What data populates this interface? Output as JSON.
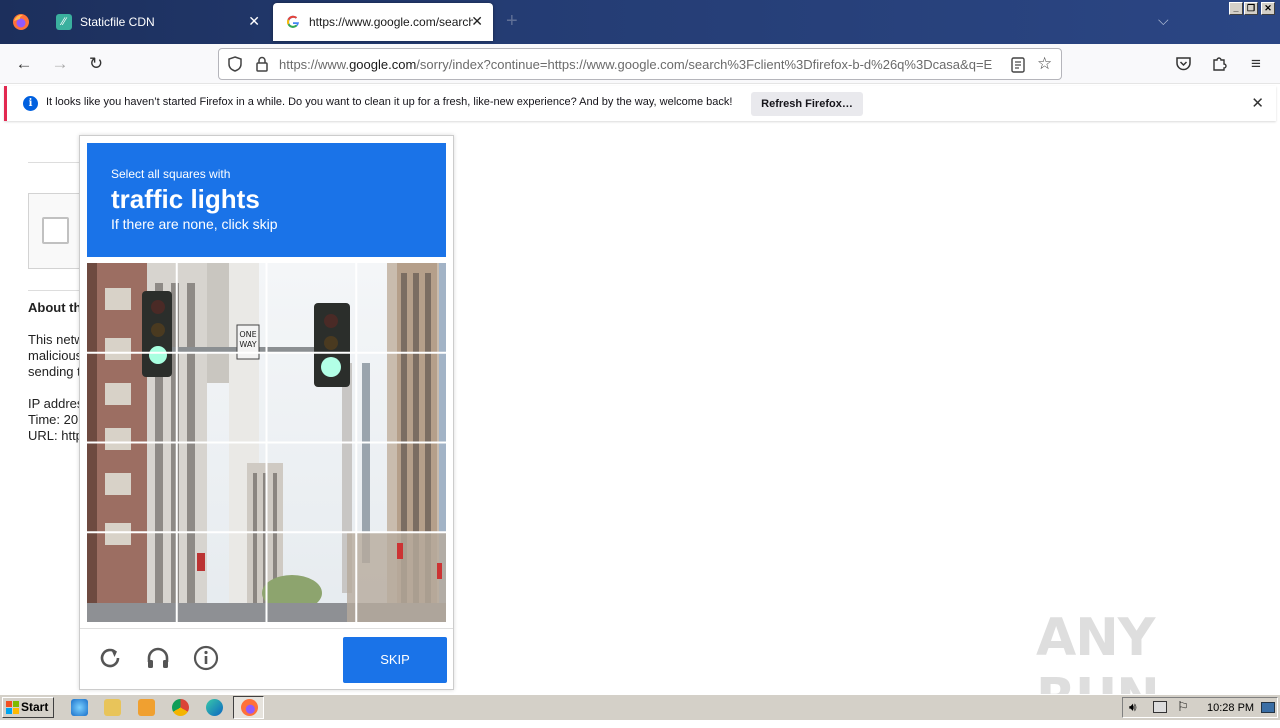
{
  "browser": {
    "tabs": [
      {
        "title": "Staticfile CDN",
        "active": false
      },
      {
        "title": "https://www.google.com/search?c",
        "active": true
      }
    ],
    "new_tab_label": "+",
    "url": {
      "prefix": "https://www.",
      "domain": "google.com",
      "rest": "/sorry/index?continue=https://www.google.com/search%3Fclient%3Dfirefox-b-d%26q%3Dcasa&q=E"
    }
  },
  "notification": {
    "message": "It looks like you haven’t started Firefox in a while. Do you want to clean it up for a fresh, like-new experience? And by the way, welcome back!",
    "button_label": "Refresh Firefox…",
    "close_label": "✕"
  },
  "page": {
    "about_heading": "About th",
    "para_lines": [
      "This netw",
      "malicious",
      "sending t"
    ],
    "ip_line": "IP addres",
    "time_line": "Time: 20",
    "url_line": "URL: http"
  },
  "captcha": {
    "instruction": "Select all squares with",
    "target": "traffic lights",
    "hint": "If there are none, click skip",
    "skip_label": "SKIP"
  },
  "watermark": "ANY RUN",
  "taskbar": {
    "start_label": "Start",
    "clock": "10:28 PM"
  },
  "colors": {
    "captcha_blue": "#1a73e8",
    "tabbar": "#243c73",
    "notification_accent": "#e22850"
  }
}
